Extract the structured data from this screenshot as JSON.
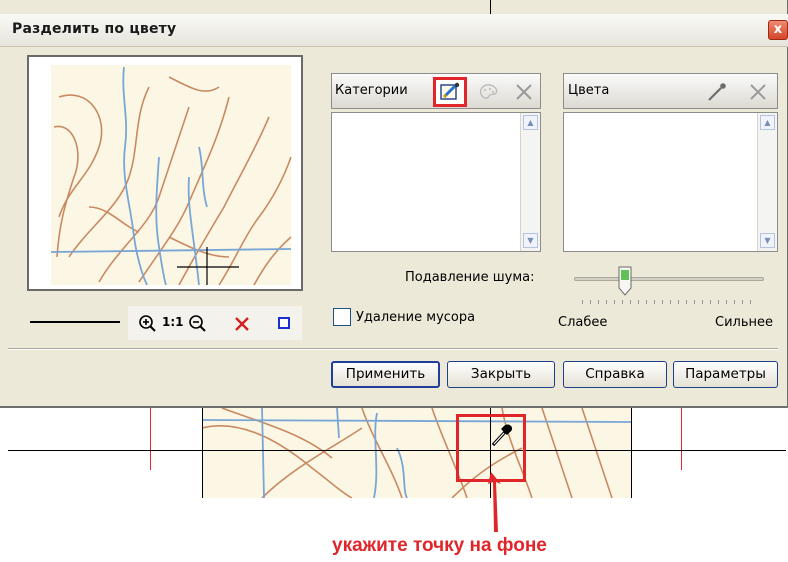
{
  "dialog": {
    "title": "Разделить по цвету",
    "close_label": "x"
  },
  "categories": {
    "label": "Категории",
    "icons": [
      "pencil-eyedropper-icon",
      "palette-icon",
      "delete-x-icon"
    ]
  },
  "colors": {
    "label": "Цвета",
    "icons": [
      "eyedropper-icon",
      "delete-x-icon"
    ]
  },
  "noise": {
    "label": "Подавление шума:",
    "weaker": "Слабее",
    "stronger": "Сильнее",
    "value_fraction": 0.27
  },
  "garbage": {
    "label": "Удаление мусора",
    "checked": false
  },
  "zoom": {
    "one_to_one": "1:1"
  },
  "buttons": {
    "apply": "Применить",
    "close": "Закрыть",
    "help": "Справка",
    "params": "Параметры"
  },
  "hint": {
    "text": "укажите точку на фоне"
  },
  "accent_colors": {
    "highlight": "#e0262a",
    "button_border": "#1e3f8a",
    "dialog_bg": "#ece9d8"
  }
}
